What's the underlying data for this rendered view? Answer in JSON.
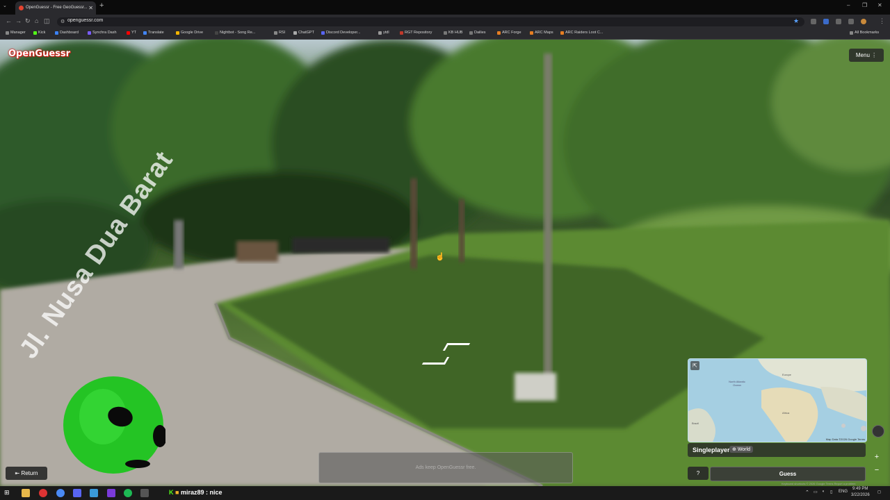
{
  "browser": {
    "tab_title": "OpenGuessr - Free GeoGuessr...",
    "new_tab": "+",
    "url": "openguessr.com",
    "window_controls": [
      "–",
      "❐",
      "✕"
    ],
    "bookmarks": [
      {
        "label": "Manager",
        "color": "#888"
      },
      {
        "label": "Kick",
        "color": "#53fc18"
      },
      {
        "label": "Dashboard",
        "color": "#3b82f6"
      },
      {
        "label": "Synchra Dash",
        "color": "#7a5cff"
      },
      {
        "label": "YT",
        "color": "#ff0000"
      },
      {
        "label": "Translate",
        "color": "#4285f4"
      },
      {
        "label": "Google Drive",
        "color": "#f4b400"
      },
      {
        "label": "Nightbot - Song Re...",
        "color": "#444"
      },
      {
        "label": "RSI",
        "color": "#888"
      },
      {
        "label": "ChatGPT",
        "color": "#aaa"
      },
      {
        "label": "Discord Developer...",
        "color": "#5865f2"
      },
      {
        "label": "ytdl",
        "color": "#999"
      },
      {
        "label": "RGT Repository",
        "color": "#c0392b"
      },
      {
        "label": "KB HUB",
        "color": "#777"
      },
      {
        "label": "Dailies",
        "color": "#777"
      },
      {
        "label": "ARC Forge",
        "color": "#e67e22"
      },
      {
        "label": "ARC Maps",
        "color": "#e67e22"
      },
      {
        "label": "ARC Raiders Loot C...",
        "color": "#e67e22"
      }
    ],
    "all_bookmarks": "All Bookmarks"
  },
  "game": {
    "logo": "OpenGuessr",
    "menu_label": "Menu",
    "street_sign": "Jl. Nusa Dua Barat",
    "return_label": "Return",
    "ad_text": "Ads keep OpenGuessr free.",
    "mode": "Singleplayer",
    "region": "World",
    "help_label": "?",
    "guess_label": "Guess",
    "map_credit": "Map Data ©2026 Google   Terms",
    "footer": "Keyboard shortcuts   © 2026 Google   Terms   Report a problem",
    "map_labels": [
      "North Atlantic Ocean",
      "Europe",
      "Africa",
      "Brazil"
    ]
  },
  "taskbar": {
    "chat_user": "miraz89",
    "chat_message": "nice",
    "lang": "ENG",
    "time": "9:49 PM",
    "date": "3/22/2026"
  }
}
